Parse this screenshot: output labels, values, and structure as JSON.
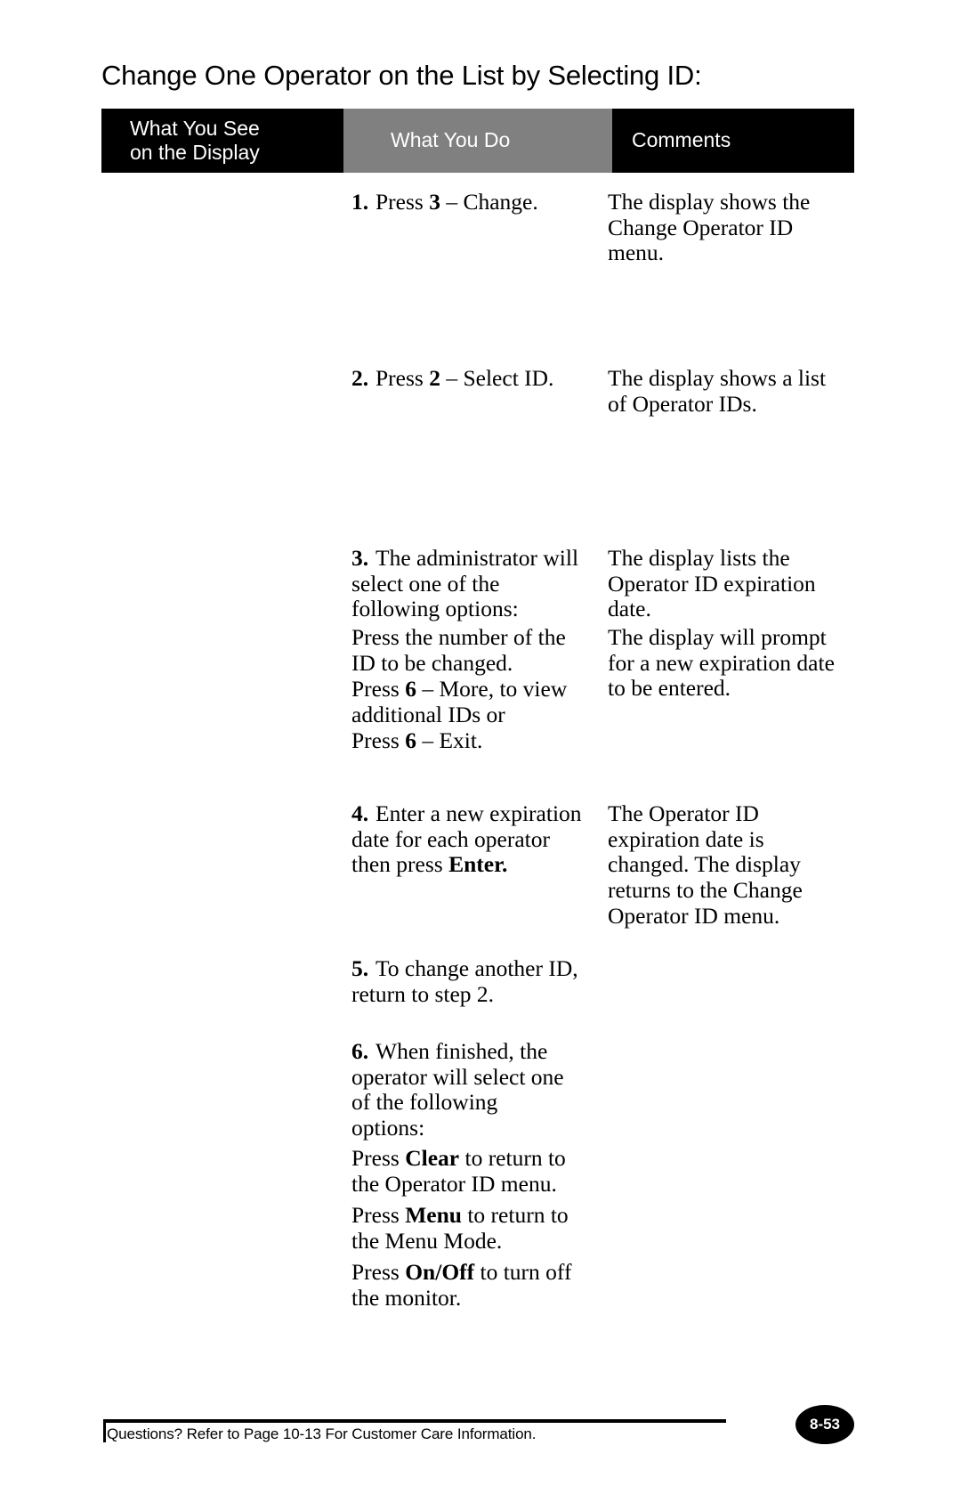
{
  "title": "Change One Operator on the List by Selecting ID:",
  "table": {
    "headers": {
      "see_line1": "What You See",
      "see_line2": "on the Display",
      "do": "What You Do",
      "comments": "Comments"
    },
    "header_colors": {
      "see_bg": "#000000",
      "do_bg": "#808080",
      "comments_bg": "#000000",
      "text": "#ffffff"
    },
    "rows": [
      {
        "number": "1.",
        "do_paragraphs": [
          {
            "prefix": "Press ",
            "bold": "3",
            "suffix": " – Change."
          }
        ],
        "comment_lines": [
          "The display shows the",
          "Change Operator ID",
          "menu."
        ]
      },
      {
        "number": "2.",
        "do_paragraphs": [
          {
            "prefix": "Press ",
            "bold": "2",
            "suffix": " – Select ID."
          }
        ],
        "comment_lines": [
          "The display shows a list",
          "of Operator IDs."
        ]
      },
      {
        "number": "3.",
        "do_paragraphs": [
          {
            "prefix": "",
            "bold": "",
            "suffix": "The administrator will select one of the following options:"
          },
          {
            "prefix": "",
            "bold": "",
            "suffix": "Press the number of the ID to be changed."
          },
          {
            "prefix": "Press ",
            "bold": "6",
            "suffix": " – More, to view additional IDs or"
          },
          {
            "prefix": "Press ",
            "bold": "6",
            "suffix": " – Exit."
          }
        ],
        "comment_blocks": [
          [
            "The display lists the",
            "Operator ID expiration",
            "date."
          ],
          [
            "The display will prompt",
            "for a new expiration date",
            "to be entered."
          ]
        ]
      },
      {
        "number": "4.",
        "do_paragraphs": [
          {
            "prefix": "Enter a new expiration date for each operator then press ",
            "bold": "Enter.",
            "suffix": ""
          }
        ],
        "comment_lines": [
          "The Operator ID",
          "expiration date is",
          "changed. The display",
          "returns to the Change",
          "Operator ID menu."
        ]
      },
      {
        "number": "5.",
        "do_paragraphs": [
          {
            "prefix": "",
            "bold": "",
            "suffix": "To change another ID, return to step 2."
          }
        ],
        "comment_lines": []
      },
      {
        "number": "6.",
        "do_paragraphs": [
          {
            "prefix": "",
            "bold": "",
            "suffix": "When finished, the operator will select one of the following options:"
          },
          {
            "prefix": "Press ",
            "bold": "Clear",
            "suffix": " to return to the Operator ID menu."
          },
          {
            "prefix": "Press ",
            "bold": "Menu",
            "suffix": " to return to the Menu Mode."
          },
          {
            "prefix": "Press ",
            "bold": "On/Off",
            "suffix": " to turn off the monitor."
          }
        ],
        "comment_lines": []
      }
    ]
  },
  "footer": {
    "note": "Questions? Refer to Page 10-13 For Customer Care Information.",
    "page_number": "8-53"
  }
}
